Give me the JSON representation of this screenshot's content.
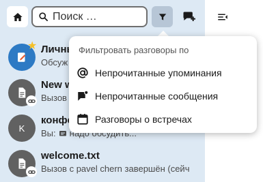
{
  "search": {
    "placeholder": "Поиск …"
  },
  "icons": {
    "home": "home-icon",
    "search": "search-icon",
    "filter": "filter-icon",
    "new_chat": "chat-plus-icon",
    "collapse": "menu-collapse-icon"
  },
  "colors": {
    "sidebar_bg": "#dde9f4",
    "filter_active_bg": "#b7c6d6",
    "avatar_blue": "#2d7ac4",
    "avatar_gray": "#616161",
    "favorite_star": "#f6c026"
  },
  "conversations": [
    {
      "title": "Личны",
      "subtitle": "Обсуж",
      "avatar": "note-icon",
      "favorite": true
    },
    {
      "title": "New w",
      "subtitle": "Вызов",
      "avatar": "document-icon",
      "link_badge": true
    },
    {
      "title": "конфе",
      "subtitle_prefix": "Вы:",
      "subtitle": "надо обсудить...",
      "avatar_initial": "K"
    },
    {
      "title": "welcome.txt",
      "subtitle": "Вызов с pavel chern завершён (сейч",
      "avatar": "document-icon",
      "link_badge": true
    }
  ],
  "filter_menu": {
    "heading": "Фильтровать разговоры по",
    "items": [
      {
        "label": "Непрочитанные упоминания",
        "icon": "at-icon"
      },
      {
        "label": "Непрочитанные сообщения",
        "icon": "message-badge-icon"
      },
      {
        "label": "Разговоры о встречах",
        "icon": "calendar-icon"
      }
    ]
  }
}
